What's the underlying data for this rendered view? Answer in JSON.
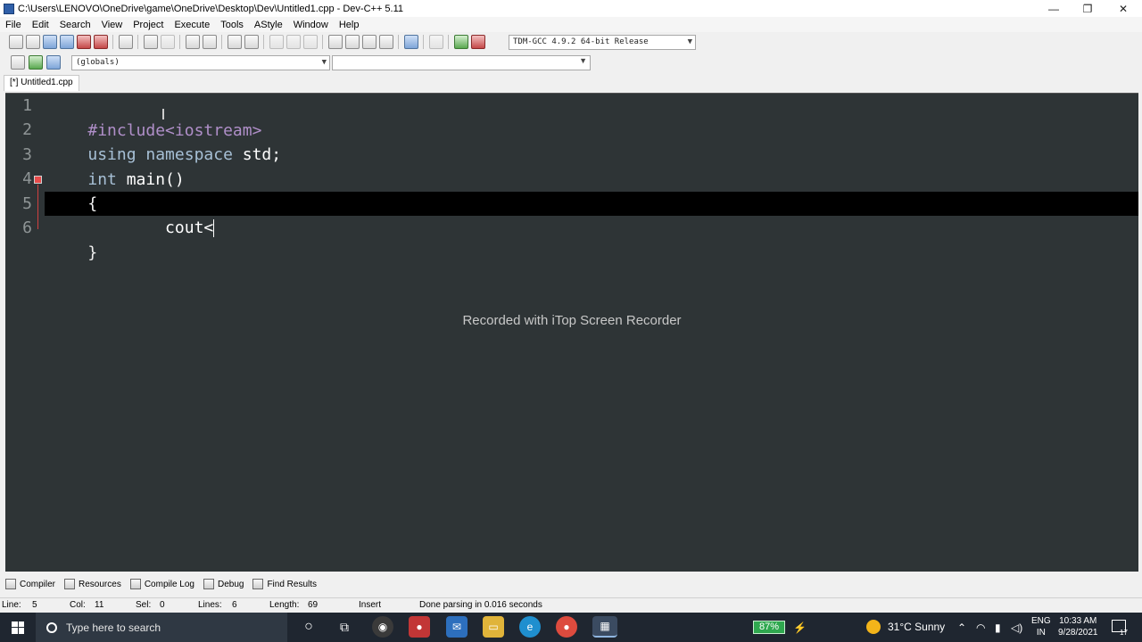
{
  "window": {
    "title": "C:\\Users\\LENOVO\\OneDrive\\game\\OneDrive\\Desktop\\Dev\\Untitled1.cpp - Dev-C++ 5.11",
    "minimize": "—",
    "maximize": "❐",
    "close": "✕"
  },
  "menu": [
    "File",
    "Edit",
    "Search",
    "View",
    "Project",
    "Execute",
    "Tools",
    "AStyle",
    "Window",
    "Help"
  ],
  "toolbar": {
    "compiler_select": "TDM-GCC 4.9.2 64-bit Release",
    "scope_select": "(globals)",
    "members_select": ""
  },
  "tabs": [
    {
      "label": "[*] Untitled1.cpp"
    }
  ],
  "editor": {
    "line_numbers": [
      "1",
      "2",
      "3",
      "4",
      "5",
      "6"
    ],
    "lines": [
      [
        {
          "t": "#include<iostream>",
          "c": "pp"
        }
      ],
      [
        {
          "t": "using namespace",
          "c": "kw"
        },
        {
          "t": " std;",
          "c": "id"
        }
      ],
      [
        {
          "t": "int",
          "c": "kw"
        },
        {
          "t": " main()",
          "c": "id"
        }
      ],
      [
        {
          "t": "{",
          "c": "sym"
        }
      ],
      [
        {
          "t": "        cout<",
          "c": "id"
        }
      ],
      [
        {
          "t": "}",
          "c": "sym"
        }
      ]
    ],
    "current_line": 5,
    "watermark": "Recorded with iTop Screen Recorder"
  },
  "bottom_tabs": [
    {
      "label": "Compiler",
      "icon": "compiler-icon"
    },
    {
      "label": "Resources",
      "icon": "resources-icon"
    },
    {
      "label": "Compile Log",
      "icon": "compile-log-icon"
    },
    {
      "label": "Debug",
      "icon": "debug-icon"
    },
    {
      "label": "Find Results",
      "icon": "find-results-icon"
    }
  ],
  "status": {
    "line_label": "Line:",
    "line_value": "5",
    "col_label": "Col:",
    "col_value": "11",
    "sel_label": "Sel:",
    "sel_value": "0",
    "lines_label": "Lines:",
    "lines_value": "6",
    "length_label": "Length:",
    "length_value": "69",
    "mode": "Insert",
    "message": "Done parsing in 0.016 seconds"
  },
  "taskbar": {
    "search_placeholder": "Type here to search",
    "battery": "87%",
    "weather": "31°C  Sunny",
    "lang_top": "ENG",
    "lang_bottom": "IN",
    "time": "10:33 AM",
    "date": "9/28/2021",
    "notifications": "17"
  },
  "colors": {
    "editor_bg": "#2e3436",
    "preprocessor": "#b08fc9",
    "keyword": "#a7c0d6",
    "taskbar_bg": "#1f2630"
  }
}
